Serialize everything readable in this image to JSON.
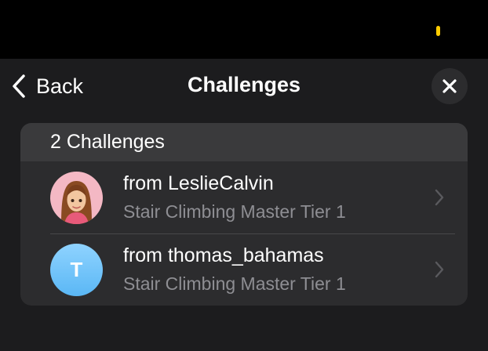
{
  "nav": {
    "back_label": "Back",
    "title": "Challenges"
  },
  "challenges": {
    "count_label": "2 Challenges",
    "items": [
      {
        "from": "from LeslieCalvin",
        "challenge": "Stair Climbing Master Tier 1",
        "avatar": "memoji-avatar"
      },
      {
        "from": "from thomas_bahamas",
        "challenge": "Stair Climbing Master Tier 1",
        "avatar_initial": "T"
      }
    ]
  },
  "colors": {
    "background": "#1c1c1e",
    "card": "#2c2c2e",
    "card_header": "#3a3a3c",
    "secondary_text": "#8e8e93",
    "status_indicator": "#ffcc00",
    "avatar_blue": "#5ab7f5"
  },
  "icons": [
    "chevron-left-icon",
    "close-icon",
    "chevron-right-icon"
  ]
}
